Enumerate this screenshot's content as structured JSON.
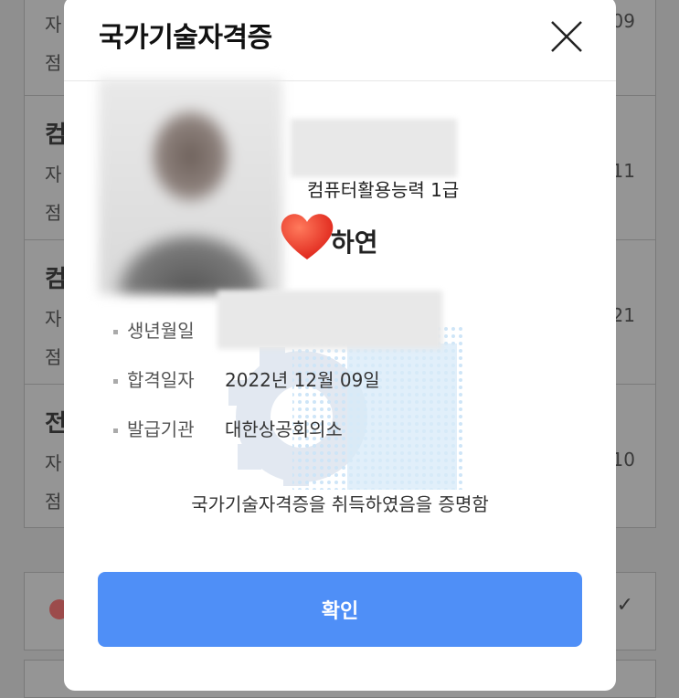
{
  "modal": {
    "title": "국가기술자격증",
    "certificate_name": "컴퓨터활용능력 1급",
    "holder_name": "하연",
    "info": [
      {
        "label": "생년월일",
        "value": ""
      },
      {
        "label": "합격일자",
        "value": "2022년 12월 09일"
      },
      {
        "label": "발급기관",
        "value": "대한상공회의소"
      }
    ],
    "statement": "국가기술자격증을 취득하였음을 증명함",
    "confirm_label": "확인"
  },
  "background": {
    "cards": [
      {
        "title": "",
        "line1": "자",
        "line2": "점",
        "right": "09"
      },
      {
        "title": "컴",
        "line1": "자",
        "line2": "점",
        "right": "11"
      },
      {
        "title": "컴",
        "line1": "자",
        "line2": "점",
        "right": "21"
      },
      {
        "title": "전",
        "line1": "자",
        "line2": "점",
        "right": "10"
      }
    ],
    "check_glyph": "✓"
  },
  "colors": {
    "accent": "#4f8ff7",
    "overlay": "#8f8f8f",
    "heart": "#f0412f"
  },
  "icons": {
    "close": "close-icon",
    "heart": "heart-sticker",
    "watermark": "gear-watermark"
  }
}
